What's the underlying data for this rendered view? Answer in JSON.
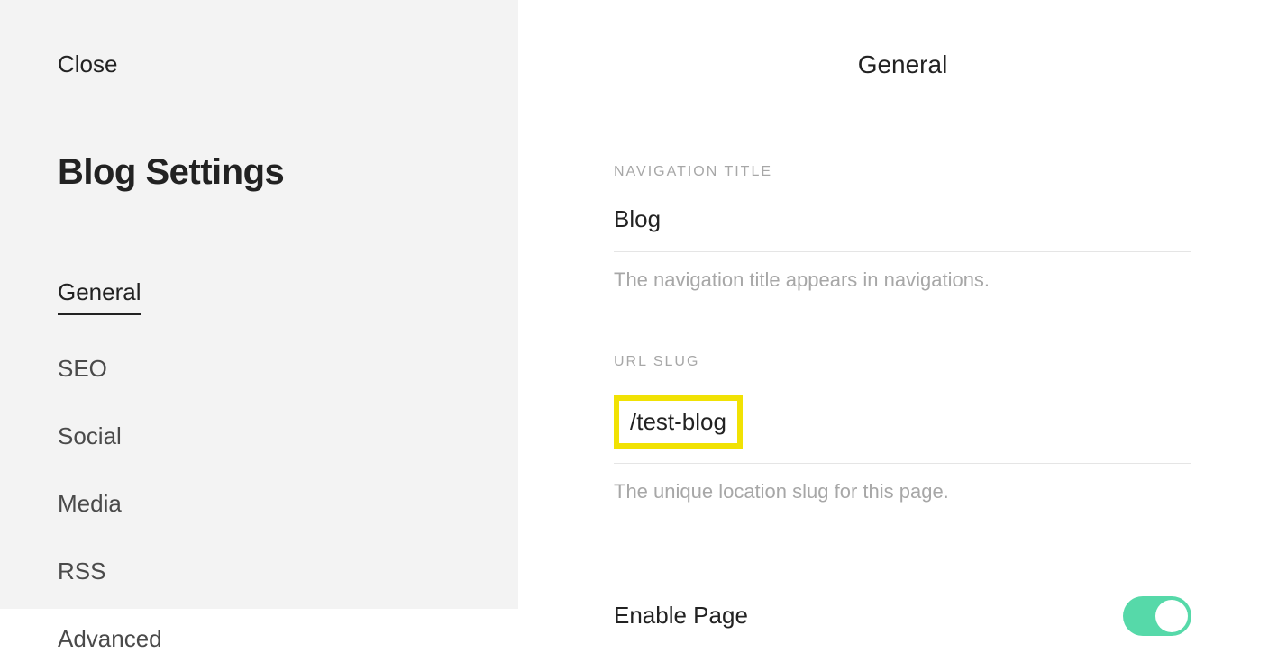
{
  "sidebar": {
    "close_label": "Close",
    "title": "Blog Settings",
    "nav_items": [
      {
        "label": "General",
        "active": true
      },
      {
        "label": "SEO",
        "active": false
      },
      {
        "label": "Social",
        "active": false
      },
      {
        "label": "Media",
        "active": false
      },
      {
        "label": "RSS",
        "active": false
      },
      {
        "label": "Advanced",
        "active": false
      }
    ]
  },
  "main": {
    "panel_title": "General",
    "navigation_title": {
      "label": "NAVIGATION TITLE",
      "value": "Blog",
      "help": "The navigation title appears in navigations."
    },
    "url_slug": {
      "label": "URL SLUG",
      "value": "/test-blog",
      "help": "The unique location slug for this page."
    },
    "enable_page": {
      "label": "Enable Page",
      "value": true
    }
  }
}
